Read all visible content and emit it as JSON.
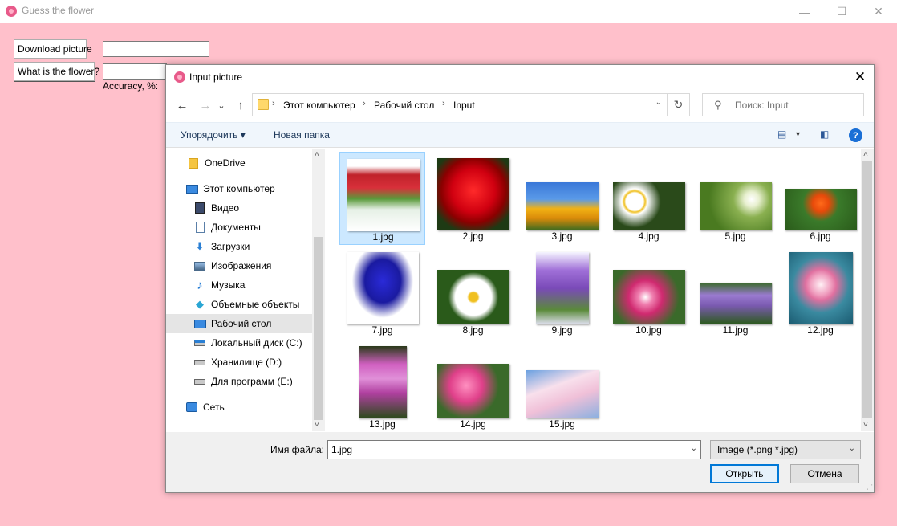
{
  "main_window": {
    "title": "Guess the flower",
    "controls": {
      "minimize": "—",
      "maximize": "☐",
      "close": "✕"
    },
    "download_button": "Download picture",
    "guess_button": "What is the flower?",
    "accuracy_label": "Accuracy, %:"
  },
  "dialog": {
    "title": "Input picture",
    "close": "✕",
    "nav": {
      "back": "←",
      "forward": "→",
      "recent": "⌄",
      "up": "↑"
    },
    "breadcrumb": [
      "Этот компьютер",
      "Рабочий стол",
      "Input"
    ],
    "breadcrumb_sep": "›",
    "address_dropdown": "⌄",
    "refresh": "↻",
    "search_placeholder": "Поиск: Input",
    "search_icon": "⚲",
    "commands": {
      "organize": "Упорядочить ▾",
      "new_folder": "Новая папка",
      "view_icon": "▤",
      "view_dd": "▾",
      "pane_icon": "◧",
      "help": "?"
    },
    "sidebar": [
      {
        "label": "OneDrive",
        "icon": "folder-icon",
        "glyph": "▮",
        "color": "#f5c542"
      },
      {
        "label": "Этот компьютер",
        "icon": "computer-icon",
        "glyph": "▭",
        "color": "#2a7fd4"
      },
      {
        "label": "Видео",
        "icon": "video-icon",
        "glyph": "▦",
        "color": "#3b4a6b"
      },
      {
        "label": "Документы",
        "icon": "documents-icon",
        "glyph": "▤",
        "color": "#5a7fa8"
      },
      {
        "label": "Загрузки",
        "icon": "downloads-icon",
        "glyph": "⬇",
        "color": "#2a7fd4"
      },
      {
        "label": "Изображения",
        "icon": "images-icon",
        "glyph": "▣",
        "color": "#4a6a8a"
      },
      {
        "label": "Музыка",
        "icon": "music-icon",
        "glyph": "♪",
        "color": "#2a7fd4"
      },
      {
        "label": "Объемные объекты",
        "icon": "3d-objects-icon",
        "glyph": "◆",
        "color": "#2aa6d4"
      },
      {
        "label": "Рабочий стол",
        "icon": "desktop-icon",
        "glyph": "▬",
        "color": "#2a7fd4"
      },
      {
        "label": "Локальный диск (C:)",
        "icon": "drive-c-icon",
        "glyph": "▭",
        "color": "#555"
      },
      {
        "label": "Хранилище (D:)",
        "icon": "drive-d-icon",
        "glyph": "▭",
        "color": "#555"
      },
      {
        "label": "Для программ (E:)",
        "icon": "drive-e-icon",
        "glyph": "▭",
        "color": "#555"
      },
      {
        "label": "Сеть",
        "icon": "network-icon",
        "glyph": "▤",
        "color": "#2a7fd4"
      }
    ],
    "scroll_up": "˄",
    "scroll_down": "˅",
    "files": [
      {
        "name": "1.jpg",
        "bg": "linear-gradient(180deg,#fff 0%,#fff 10%,#c0222a 22%,#d8303a 40%,#5a9a3a 55%,#e6f0e6 70%,#fff 100%)"
      },
      {
        "name": "2.jpg",
        "bg": "radial-gradient(circle at 50% 45%,#ff2a2a 0%,#d00010 40%,#8a0000 60%,#1e3a14 80%)"
      },
      {
        "name": "3.jpg",
        "bg": "linear-gradient(180deg,#3a78d8 0%,#5a9ae8 35%,#f2b214 55%,#d88a0a 75%,#3a6a20 100%)"
      },
      {
        "name": "4.jpg",
        "bg": "radial-gradient(circle at 30% 40%,#fff 0%,#fff 15%,#f0c020 18%,#fff 22%,#2a4a1a 45%),radial-gradient(circle at 75% 45%,#fff 0%,#fff 15%,#f0c020 18%,#1a3a10 40%)"
      },
      {
        "name": "5.jpg",
        "bg": "radial-gradient(circle at 72% 35%,#ffffff 0%,#e8f0d0 12%,#8ab050 30%,#4a7a20 70%)"
      },
      {
        "name": "6.jpg",
        "bg": "radial-gradient(circle at 50% 35%,#ff6a1a 0%,#e84a0a 18%,#3a7a2a 40%,#2a5a1a 100%)"
      },
      {
        "name": "7.jpg",
        "bg": "radial-gradient(ellipse at 50% 40%,#2a2ad8 0%,#1a1aa0 35%,#ffffff 60%)"
      },
      {
        "name": "8.jpg",
        "bg": "radial-gradient(circle at 50% 50%,#f0c020 0%,#f0c020 10%,#ffffff 14%,#ffffff 40%,#2a5a1a 55%)"
      },
      {
        "name": "9.jpg",
        "bg": "linear-gradient(180deg,#f5f5ff 0%,#a070d8 25%,#7a4ab8 50%,#5a8a3a 80%,#e0e0f0 100%)"
      },
      {
        "name": "10.jpg",
        "bg": "radial-gradient(circle at 45% 50%,#ffffff 0%,#f080b0 15%,#d02a70 35%,#3a6a2a 70%)"
      },
      {
        "name": "11.jpg",
        "bg": "linear-gradient(180deg,#3a6a2a 0%,#9a7ad0 30%,#7a5ab0 55%,#2a5a1a 100%)"
      },
      {
        "name": "12.jpg",
        "bg": "radial-gradient(circle at 50% 45%,#fff0f5 0%,#f0a0c0 20%,#e070a0 30%,#3a8aa0 55%,#1a5a70 100%)"
      },
      {
        "name": "13.jpg",
        "bg": "linear-gradient(180deg,#2a3a1a 0%,#d060c0 25%,#e090d8 45%,#b040a0 65%,#2a4a1a 100%)"
      },
      {
        "name": "14.jpg",
        "bg": "radial-gradient(circle at 40% 40%,#ff90c0 0%,#e0408a 30%,#3a6a2a 60%)"
      },
      {
        "name": "15.jpg",
        "bg": "linear-gradient(160deg,#6aa0e0 0%,#f8e0ec 35%,#f0c0d8 60%,#8ab0e0 100%)"
      }
    ],
    "filename_label": "Имя файла:",
    "filename_value": "1.jpg",
    "filename_dropdown": "⌄",
    "filetype": "Image (*.png *.jpg)",
    "filetype_dropdown": "⌄",
    "open_button": "Открыть",
    "cancel_button": "Отмена",
    "resize_grip": "⋰"
  }
}
